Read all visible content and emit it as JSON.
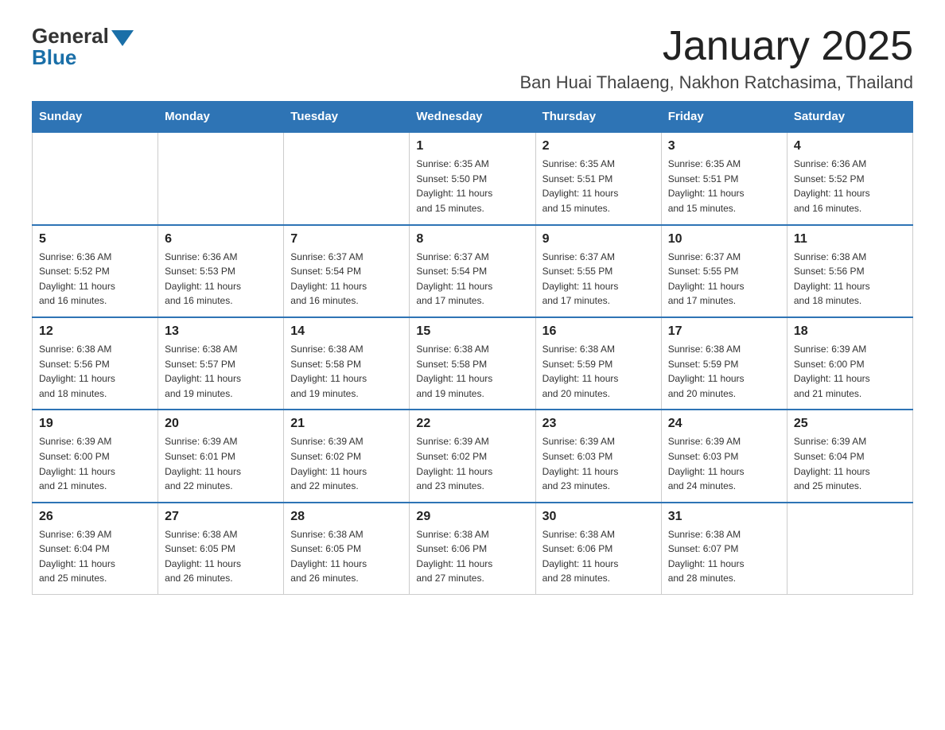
{
  "logo": {
    "general": "General",
    "blue": "Blue"
  },
  "header": {
    "title": "January 2025",
    "subtitle": "Ban Huai Thalaeng, Nakhon Ratchasima, Thailand"
  },
  "days_of_week": [
    "Sunday",
    "Monday",
    "Tuesday",
    "Wednesday",
    "Thursday",
    "Friday",
    "Saturday"
  ],
  "weeks": [
    [
      {
        "day": "",
        "info": ""
      },
      {
        "day": "",
        "info": ""
      },
      {
        "day": "",
        "info": ""
      },
      {
        "day": "1",
        "info": "Sunrise: 6:35 AM\nSunset: 5:50 PM\nDaylight: 11 hours\nand 15 minutes."
      },
      {
        "day": "2",
        "info": "Sunrise: 6:35 AM\nSunset: 5:51 PM\nDaylight: 11 hours\nand 15 minutes."
      },
      {
        "day": "3",
        "info": "Sunrise: 6:35 AM\nSunset: 5:51 PM\nDaylight: 11 hours\nand 15 minutes."
      },
      {
        "day": "4",
        "info": "Sunrise: 6:36 AM\nSunset: 5:52 PM\nDaylight: 11 hours\nand 16 minutes."
      }
    ],
    [
      {
        "day": "5",
        "info": "Sunrise: 6:36 AM\nSunset: 5:52 PM\nDaylight: 11 hours\nand 16 minutes."
      },
      {
        "day": "6",
        "info": "Sunrise: 6:36 AM\nSunset: 5:53 PM\nDaylight: 11 hours\nand 16 minutes."
      },
      {
        "day": "7",
        "info": "Sunrise: 6:37 AM\nSunset: 5:54 PM\nDaylight: 11 hours\nand 16 minutes."
      },
      {
        "day": "8",
        "info": "Sunrise: 6:37 AM\nSunset: 5:54 PM\nDaylight: 11 hours\nand 17 minutes."
      },
      {
        "day": "9",
        "info": "Sunrise: 6:37 AM\nSunset: 5:55 PM\nDaylight: 11 hours\nand 17 minutes."
      },
      {
        "day": "10",
        "info": "Sunrise: 6:37 AM\nSunset: 5:55 PM\nDaylight: 11 hours\nand 17 minutes."
      },
      {
        "day": "11",
        "info": "Sunrise: 6:38 AM\nSunset: 5:56 PM\nDaylight: 11 hours\nand 18 minutes."
      }
    ],
    [
      {
        "day": "12",
        "info": "Sunrise: 6:38 AM\nSunset: 5:56 PM\nDaylight: 11 hours\nand 18 minutes."
      },
      {
        "day": "13",
        "info": "Sunrise: 6:38 AM\nSunset: 5:57 PM\nDaylight: 11 hours\nand 19 minutes."
      },
      {
        "day": "14",
        "info": "Sunrise: 6:38 AM\nSunset: 5:58 PM\nDaylight: 11 hours\nand 19 minutes."
      },
      {
        "day": "15",
        "info": "Sunrise: 6:38 AM\nSunset: 5:58 PM\nDaylight: 11 hours\nand 19 minutes."
      },
      {
        "day": "16",
        "info": "Sunrise: 6:38 AM\nSunset: 5:59 PM\nDaylight: 11 hours\nand 20 minutes."
      },
      {
        "day": "17",
        "info": "Sunrise: 6:38 AM\nSunset: 5:59 PM\nDaylight: 11 hours\nand 20 minutes."
      },
      {
        "day": "18",
        "info": "Sunrise: 6:39 AM\nSunset: 6:00 PM\nDaylight: 11 hours\nand 21 minutes."
      }
    ],
    [
      {
        "day": "19",
        "info": "Sunrise: 6:39 AM\nSunset: 6:00 PM\nDaylight: 11 hours\nand 21 minutes."
      },
      {
        "day": "20",
        "info": "Sunrise: 6:39 AM\nSunset: 6:01 PM\nDaylight: 11 hours\nand 22 minutes."
      },
      {
        "day": "21",
        "info": "Sunrise: 6:39 AM\nSunset: 6:02 PM\nDaylight: 11 hours\nand 22 minutes."
      },
      {
        "day": "22",
        "info": "Sunrise: 6:39 AM\nSunset: 6:02 PM\nDaylight: 11 hours\nand 23 minutes."
      },
      {
        "day": "23",
        "info": "Sunrise: 6:39 AM\nSunset: 6:03 PM\nDaylight: 11 hours\nand 23 minutes."
      },
      {
        "day": "24",
        "info": "Sunrise: 6:39 AM\nSunset: 6:03 PM\nDaylight: 11 hours\nand 24 minutes."
      },
      {
        "day": "25",
        "info": "Sunrise: 6:39 AM\nSunset: 6:04 PM\nDaylight: 11 hours\nand 25 minutes."
      }
    ],
    [
      {
        "day": "26",
        "info": "Sunrise: 6:39 AM\nSunset: 6:04 PM\nDaylight: 11 hours\nand 25 minutes."
      },
      {
        "day": "27",
        "info": "Sunrise: 6:38 AM\nSunset: 6:05 PM\nDaylight: 11 hours\nand 26 minutes."
      },
      {
        "day": "28",
        "info": "Sunrise: 6:38 AM\nSunset: 6:05 PM\nDaylight: 11 hours\nand 26 minutes."
      },
      {
        "day": "29",
        "info": "Sunrise: 6:38 AM\nSunset: 6:06 PM\nDaylight: 11 hours\nand 27 minutes."
      },
      {
        "day": "30",
        "info": "Sunrise: 6:38 AM\nSunset: 6:06 PM\nDaylight: 11 hours\nand 28 minutes."
      },
      {
        "day": "31",
        "info": "Sunrise: 6:38 AM\nSunset: 6:07 PM\nDaylight: 11 hours\nand 28 minutes."
      },
      {
        "day": "",
        "info": ""
      }
    ]
  ]
}
